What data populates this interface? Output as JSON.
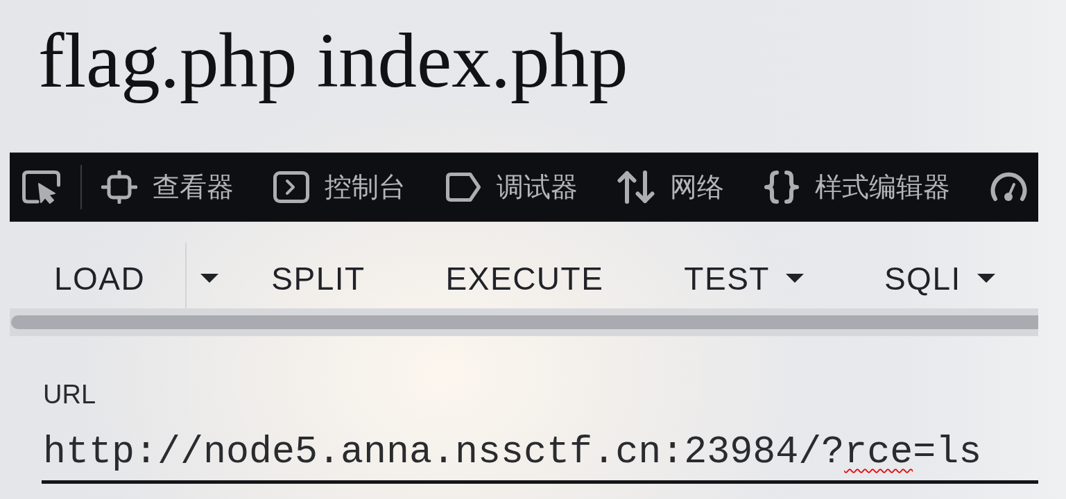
{
  "heading": "flag.php index.php",
  "devtools": {
    "tabs": [
      {
        "kind": "inspector",
        "label": "查看器"
      },
      {
        "kind": "console",
        "label": "控制台"
      },
      {
        "kind": "debugger",
        "label": "调试器"
      },
      {
        "kind": "network",
        "label": "网络"
      },
      {
        "kind": "style_editor",
        "label": "样式编辑器"
      },
      {
        "kind": "performance"
      }
    ]
  },
  "hackbar": {
    "buttons": [
      {
        "kind": "split",
        "label": "LOAD"
      },
      {
        "kind": "plain",
        "label": "SPLIT"
      },
      {
        "kind": "plain",
        "label": "EXECUTE"
      },
      {
        "kind": "menu",
        "label": "TEST"
      },
      {
        "kind": "menu",
        "label": "SQLI"
      }
    ]
  },
  "url_field": {
    "label": "URL",
    "value_parts": [
      {
        "text": "http://node5.anna.nssctf.cn:23984/?",
        "misspelled": false
      },
      {
        "text": "rce",
        "misspelled": true
      },
      {
        "text": "=ls",
        "misspelled": false
      }
    ]
  }
}
